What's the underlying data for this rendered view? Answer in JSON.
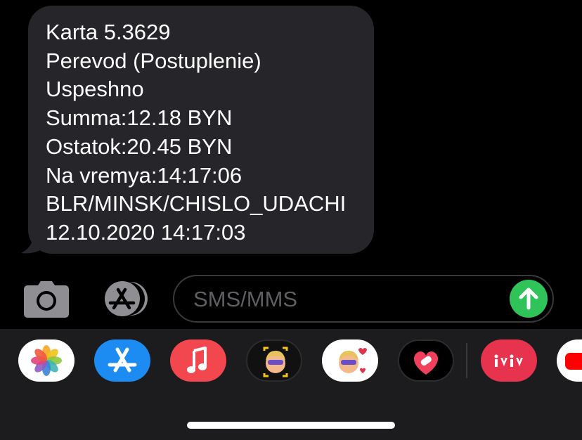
{
  "message": {
    "lines": [
      "Karta 5.3629",
      "Perevod (Postuplenie)",
      "Uspeshno",
      "Summa:12.18 BYN",
      "Ostatok:20.45 BYN",
      "Na vremya:14:17:06",
      "BLR/MINSK/CHISLO_UDACHI",
      "12.10.2020 14:17:03"
    ]
  },
  "composer": {
    "placeholder": "SMS/MMS",
    "camera_icon": "camera-icon",
    "appstore_icon": "app-store-icon",
    "send_icon": "arrow-up-icon"
  },
  "app_drawer": {
    "apps": [
      {
        "name": "Photos",
        "icon": "photos-icon"
      },
      {
        "name": "App Store",
        "icon": "app-store-icon"
      },
      {
        "name": "Music",
        "icon": "music-note-icon"
      },
      {
        "name": "Memoji",
        "icon": "memoji-icon"
      },
      {
        "name": "Memoji Stickers",
        "icon": "memoji-stickers-icon"
      },
      {
        "name": "Digital Touch",
        "icon": "digital-touch-icon"
      },
      {
        "name": "ivi",
        "icon": "ivi-icon"
      },
      {
        "name": "YouTube",
        "icon": "youtube-icon"
      }
    ]
  },
  "colors": {
    "bubble": "#26252a",
    "send": "#30c35a",
    "drawer": "#1c1c1e"
  }
}
